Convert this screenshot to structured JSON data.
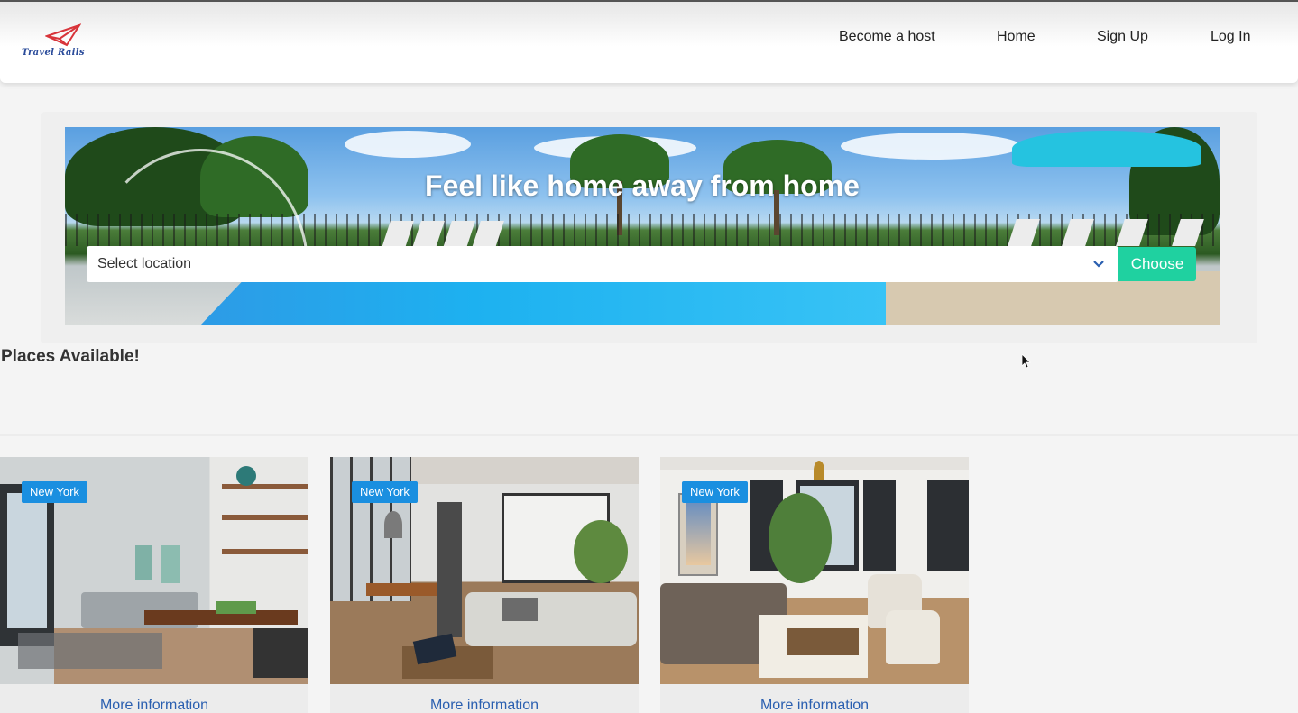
{
  "brand": {
    "logo_text": "Travel Rails"
  },
  "nav": {
    "items": [
      {
        "label": "Become a host"
      },
      {
        "label": "Home"
      },
      {
        "label": "Sign Up"
      },
      {
        "label": "Log In"
      }
    ]
  },
  "hero": {
    "title": "Feel like home away from home",
    "select_placeholder": "Select location",
    "choose_label": "Choose"
  },
  "section": {
    "title": "Places Available!"
  },
  "listings": [
    {
      "badge": "New York",
      "link": "More information"
    },
    {
      "badge": "New York",
      "link": "More information"
    },
    {
      "badge": "New York",
      "link": "More information"
    }
  ],
  "colors": {
    "accent_green": "#1fd1a0",
    "badge_blue": "#1a8fe0",
    "link_blue": "#2a5fb0"
  }
}
